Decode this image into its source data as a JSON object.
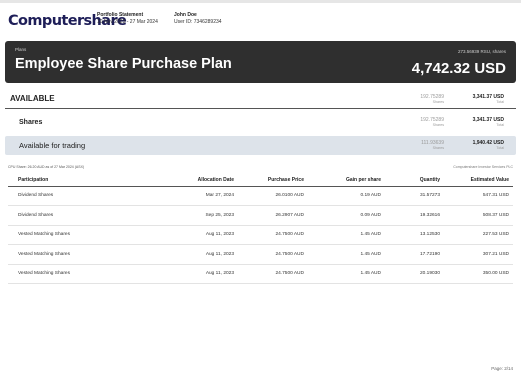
{
  "header": {
    "logo": "Computershare",
    "statement_title": "Portfolio Statement",
    "statement_period": "10 Nov 2023 - 27 Mar 2024",
    "user_name": "John Doe",
    "user_id": "User ID: 7346289234"
  },
  "banner": {
    "small_label": "Plans",
    "title": "Employee Share Purchase Plan",
    "units_label": "273.56939 RSU, shares",
    "total_value": "4,742.32 USD"
  },
  "summary": {
    "available": {
      "label": "AVAILABLE",
      "shares": "192.75289",
      "shares_caption": "Shares",
      "value": "3,341.37 USD",
      "value_caption": "Total"
    },
    "shares": {
      "label": "Shares",
      "shares": "192.75289",
      "shares_caption": "Shares",
      "value": "3,341.37 USD",
      "value_caption": "Total"
    },
    "trading": {
      "label": "Available for trading",
      "shares": "111.93639",
      "shares_caption": "Shares",
      "value": "1,940.42 USD",
      "value_caption": "Total"
    }
  },
  "notes": {
    "price_note": "CPU Share: 26.20 AUD as of 27 Mar 2024 (ASX)",
    "provider": "Computershare Investor Services PLC"
  },
  "table": {
    "headers": [
      "Participation",
      "Allocation Date",
      "Purchase Price",
      "Gain per share",
      "Quantity",
      "Estimated Value"
    ],
    "rows": [
      [
        "Dividend Shares",
        "Mar 27, 2024",
        "26.0100 AUD",
        "0.19 AUD",
        "31.57273",
        "547.31 USD"
      ],
      [
        "Dividend Shares",
        "Sep 25, 2023",
        "26.2907 AUD",
        "0.09 AUD",
        "19.32616",
        "508.37 USD"
      ],
      [
        "Vested Matching Shares",
        "Aug 11, 2023",
        "24.7500 AUD",
        "1.45 AUD",
        "13.12530",
        "227.53 USD"
      ],
      [
        "Vested Matching Shares",
        "Aug 11, 2023",
        "24.7500 AUD",
        "1.45 AUD",
        "17.72190",
        "307.21 USD"
      ],
      [
        "Vested Matching Shares",
        "Aug 11, 2023",
        "24.7500 AUD",
        "1.45 AUD",
        "20.19030",
        "350.00 USD"
      ]
    ]
  },
  "footer": {
    "page": "Page: 2/14"
  }
}
